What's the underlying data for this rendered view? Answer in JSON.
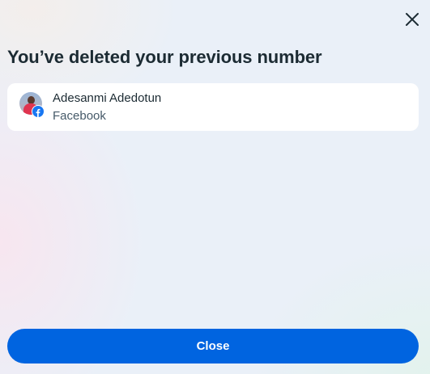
{
  "dialog": {
    "title": "You’ve deleted your previous number",
    "close_icon": "close-icon"
  },
  "account": {
    "name": "Adesanmi Adedotun",
    "platform": "Facebook",
    "avatar": "profile-photo",
    "badge_icon": "facebook-icon"
  },
  "footer": {
    "close_label": "Close"
  },
  "colors": {
    "primary": "#0064e0",
    "facebook_blue": "#1877f2",
    "text_primary": "#1c2b33",
    "text_secondary": "#465a69",
    "card_background": "#ffffff"
  }
}
